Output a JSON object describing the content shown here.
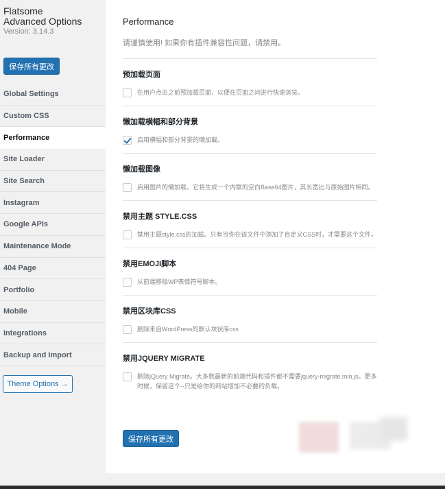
{
  "brand": {
    "name_line1": "Flatsome",
    "name_line2": "Advanced Options",
    "version": "Version: 3.14.3"
  },
  "sidebar": {
    "save_label": "保存所有更改",
    "items": [
      {
        "label": "Global Settings",
        "active": false
      },
      {
        "label": "Custom CSS",
        "active": false
      },
      {
        "label": "Performance",
        "active": true
      },
      {
        "label": "Site Loader",
        "active": false
      },
      {
        "label": "Site Search",
        "active": false
      },
      {
        "label": "Instagram",
        "active": false
      },
      {
        "label": "Google APIs",
        "active": false
      },
      {
        "label": "Maintenance Mode",
        "active": false
      },
      {
        "label": "404 Page",
        "active": false
      },
      {
        "label": "Portfolio",
        "active": false
      },
      {
        "label": "Mobile",
        "active": false
      },
      {
        "label": "Integrations",
        "active": false
      },
      {
        "label": "Backup and Import",
        "active": false
      }
    ],
    "theme_options_label": "Theme Options →"
  },
  "main": {
    "title": "Performance",
    "warning": "请谨慎使用! 如果你有插件兼容性问题，请禁用。",
    "sections": [
      {
        "title": "预加载页面",
        "desc": "在用户点击之前预加载页面，以便在页面之间进行快速浏览。",
        "checked": false
      },
      {
        "title": "懒加载横幅和部分背景",
        "desc": "启用横幅和部分背景的懒加载。",
        "checked": true
      },
      {
        "title": "懒加载图像",
        "desc": "启用图片的懒加载。它将生成一个内联的空白Base64图片，其长宽比与原始图片相同。",
        "checked": false
      },
      {
        "title": "禁用主题 STYLE.CSS",
        "desc": "禁用主题style.css的加载。只有当你在该文件中添加了自定义CSS时，才需要这个文件。",
        "checked": false
      },
      {
        "title": "禁用EMOJI脚本",
        "desc": "从前端移除WP表情符号脚本。",
        "checked": false
      },
      {
        "title": "禁用区块库CSS",
        "desc": "删除来自WordPress的默认块状库css",
        "checked": false
      },
      {
        "title": "禁用JQUERY MIGRATE",
        "desc": "删除jQuery Migrate。大多数最新的前端代码和插件都不需要jquery-migrate.min.js。更多时候，保留这个--只是给你的网站增加不必要的负载。",
        "checked": false
      }
    ],
    "save_label": "保存所有更改"
  },
  "colors": {
    "accent": "#2271b1",
    "sidebar_bg": "#f1f1f1",
    "content_bg": "#ffffff"
  }
}
